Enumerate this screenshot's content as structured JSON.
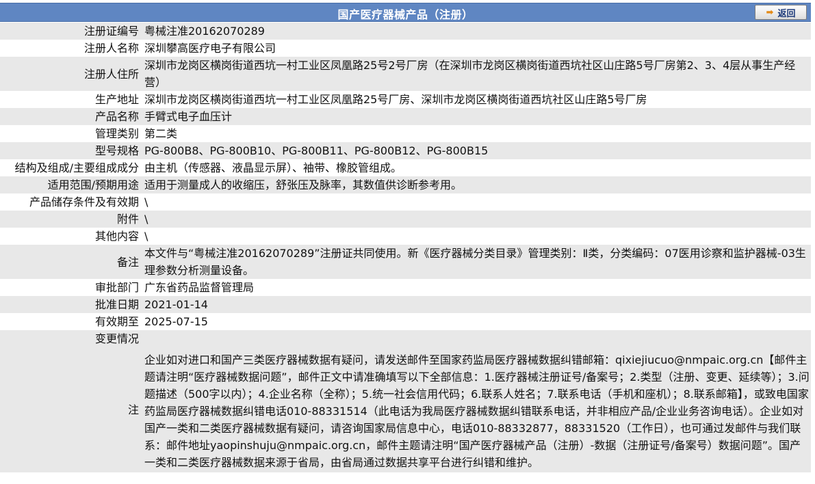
{
  "header": {
    "title": "国产医疗器械产品（注册）",
    "back_label": "返回"
  },
  "rows": [
    {
      "label": "注册证编号",
      "value": "粤械注准20162070289"
    },
    {
      "label": "注册人名称",
      "value": "深圳攀高医疗电子有限公司"
    },
    {
      "label": "注册人住所",
      "value": "深圳市龙岗区横岗街道西坑一村工业区凤凰路25号2号厂房（在深圳市龙岗区横岗街道西坑社区山庄路5号厂房第2、3、4层从事生产经营）"
    },
    {
      "label": "生产地址",
      "value": "深圳市龙岗区横岗街道西坑一村工业区凤凰路25号厂房、深圳市龙岗区横岗街道西坑社区山庄路5号厂房"
    },
    {
      "label": "产品名称",
      "value": "手臂式电子血压计"
    },
    {
      "label": "管理类别",
      "value": "第二类"
    },
    {
      "label": "型号规格",
      "value": "PG-800B8、PG-800B10、PG-800B11、PG-800B12、PG-800B15"
    },
    {
      "label": "结构及组成/主要组成成分",
      "value": "由主机（传感器、液晶显示屏）、袖带、橡胶管组成。"
    },
    {
      "label": "适用范围/预期用途",
      "value": "适用于测量成人的收缩压，舒张压及脉率，其数值供诊断参考用。"
    },
    {
      "label": "产品储存条件及有效期",
      "value": "\\"
    },
    {
      "label": "附件",
      "value": "\\"
    },
    {
      "label": "其他内容",
      "value": "\\"
    },
    {
      "label": "备注",
      "value": "本文件与“粤械注准20162070289”注册证共同使用。新《医疗器械分类目录》管理类别：Ⅱ类，分类编码：07医用诊察和监护器械-03生理参数分析测量设备。"
    },
    {
      "label": "审批部门",
      "value": "广东省药品监督管理局"
    },
    {
      "label": "批准日期",
      "value": "2021-01-14"
    },
    {
      "label": "有效期至",
      "value": "2025-07-15"
    },
    {
      "label": "变更情况",
      "value": ""
    }
  ],
  "note": {
    "label": "注",
    "text": "企业如对进口和国产三类医疗器械数据有疑问，请发送邮件至国家药监局医疗器械数据纠错邮箱：qixiejiucuo@nmpaic.org.cn【邮件主题请注明“医疗器械数据问题”，邮件正文中请准确填写以下全部信息：1.医疗器械注册证号/备案号；2.类型（注册、变更、延续等）；3.问题描述（500字以内）；4.企业名称（全称）；5.统一社会信用代码；6.联系人姓名；7.联系电话（手机和座机）；8.联系邮箱】，或致电国家药监局医疗器械数据纠错电话010-88331514（此电话为我局医疗器械数据纠错联系电话，并非相应产品/企业业务咨询电话）。企业如对国产一类和二类医疗器械数据有疑问，请咨询国家局信息中心，电话010-88332877，88331520（工作日），也可通过发邮件与我们联系：邮件地址yaopinshuju@nmpaic.org.cn，邮件主题请注明“国产医疗器械产品（注册）-数据（注册证号/备案号）数据问题”。国产一类和二类医疗器械数据来源于省局，由省局通过数据共享平台进行纠错和维护。"
  }
}
